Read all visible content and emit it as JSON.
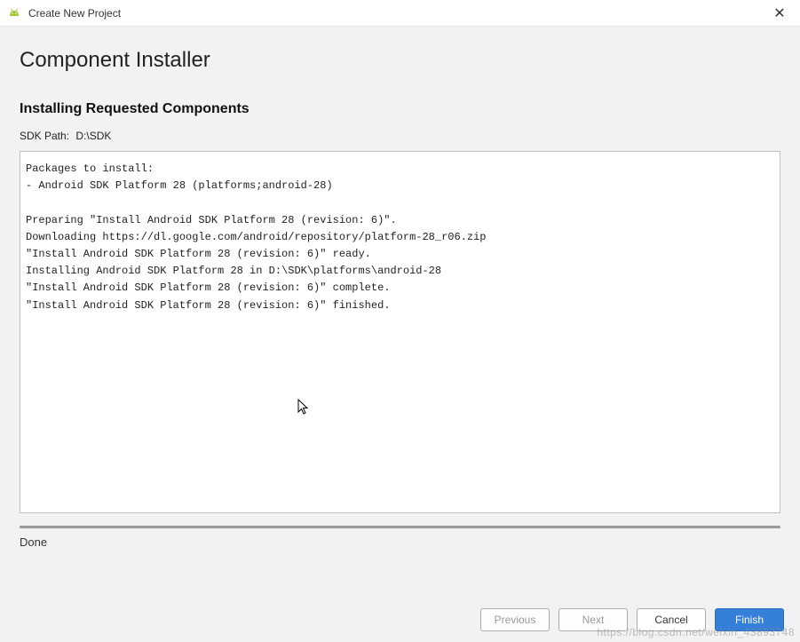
{
  "titlebar": {
    "title": "Create New Project",
    "close_glyph": "✕"
  },
  "page": {
    "title": "Component Installer",
    "section_heading": "Installing Requested Components",
    "sdk_path_label": "SDK Path:",
    "sdk_path_value": "D:\\SDK",
    "log": "Packages to install:\n- Android SDK Platform 28 (platforms;android-28)\n\nPreparing \"Install Android SDK Platform 28 (revision: 6)\".\nDownloading https://dl.google.com/android/repository/platform-28_r06.zip\n\"Install Android SDK Platform 28 (revision: 6)\" ready.\nInstalling Android SDK Platform 28 in D:\\SDK\\platforms\\android-28\n\"Install Android SDK Platform 28 (revision: 6)\" complete.\n\"Install Android SDK Platform 28 (revision: 6)\" finished.",
    "status": "Done"
  },
  "buttons": {
    "previous": "Previous",
    "next": "Next",
    "cancel": "Cancel",
    "finish": "Finish"
  },
  "watermark": "https://blog.csdn.net/weixin_43893748"
}
